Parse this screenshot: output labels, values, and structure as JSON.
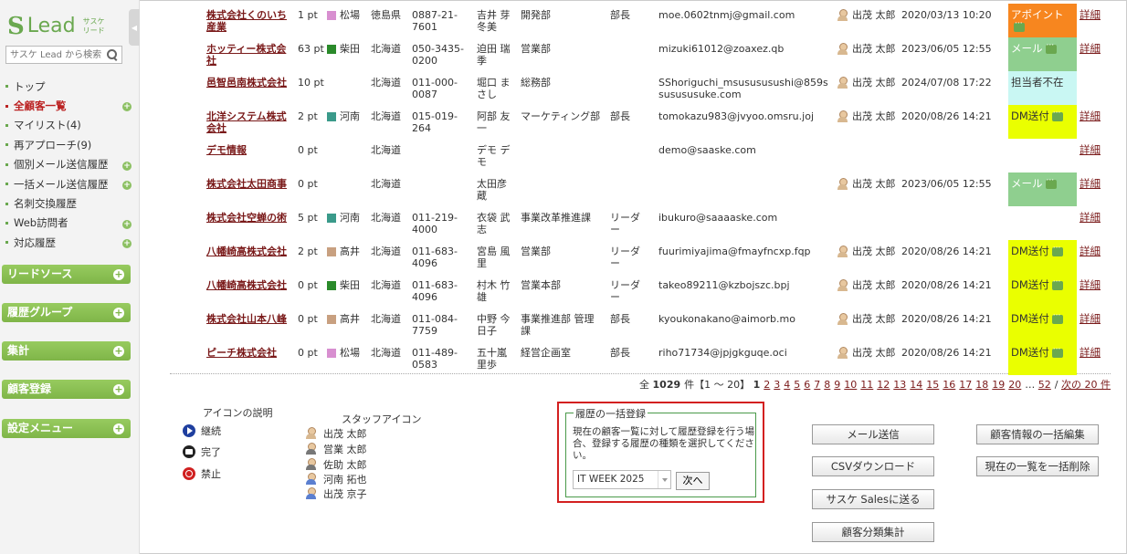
{
  "sidebar": {
    "logo_lead": "Lead",
    "logo_sub": "サスケ リード",
    "search_placeholder": "サスケ Lead から検索",
    "nav": [
      {
        "label": "トップ",
        "plus": false,
        "active": false
      },
      {
        "label": "全顧客一覧",
        "plus": true,
        "active": true
      },
      {
        "label": "マイリスト(4)",
        "plus": false,
        "active": false
      },
      {
        "label": "再アプローチ(9)",
        "plus": false,
        "active": false
      },
      {
        "label": "個別メール送信履歴",
        "plus": true,
        "active": false
      },
      {
        "label": "一括メール送信履歴",
        "plus": true,
        "active": false
      },
      {
        "label": "名刺交換履歴",
        "plus": false,
        "active": false
      },
      {
        "label": "Web訪問者",
        "plus": true,
        "active": false
      },
      {
        "label": "対応履歴",
        "plus": true,
        "active": false
      }
    ],
    "sections": [
      "リードソース",
      "履歴グループ",
      "集計",
      "顧客登録",
      "設定メニュー"
    ]
  },
  "rows": [
    {
      "company": "株式会社くのいち産業",
      "pt": "1 pt",
      "color": "#d88fd0",
      "staff": "松場",
      "pref": "徳島県",
      "tel": "0887-21-7601",
      "name": "吉井 芽冬美",
      "dept": "開発部",
      "title": "部長",
      "email": "moe.0602tnmj@gmail.com",
      "person": "出茂 太郎",
      "date": "2020/03/13 10:20",
      "status": "アポイント",
      "status_class": "st-appt",
      "bubble": true,
      "detail": "詳細"
    },
    {
      "company": "ホッティー株式会社",
      "pt": "63 pt",
      "color": "#2a8a2a",
      "staff": "柴田",
      "pref": "北海道",
      "tel": "050-3435-0200",
      "name": "迫田 瑞季",
      "dept": "営業部",
      "title": "",
      "email": "mizuki61012@zoaxez.qb",
      "person": "出茂 太郎",
      "date": "2023/06/05 12:55",
      "status": "メール",
      "status_class": "st-mail",
      "bubble": true,
      "detail": "詳細"
    },
    {
      "company": "邑智邑南株式会社",
      "pt": "10 pt",
      "color": "",
      "staff": "",
      "pref": "北海道",
      "tel": "011-000-0087",
      "name": "堀口 まさし",
      "dept": "総務部",
      "title": "",
      "email": "SShoriguchi_msusususushi@859ssusususuke.com",
      "person": "出茂 太郎",
      "date": "2024/07/08 17:22",
      "status": "担当者不在",
      "status_class": "st-absent",
      "bubble": false,
      "detail": ""
    },
    {
      "company": "北洋システム株式会社",
      "pt": "2 pt",
      "color": "#3a9a8a",
      "staff": "河南",
      "pref": "北海道",
      "tel": "015-019-264",
      "name": "阿部 友一",
      "dept": "マーケティング部",
      "title": "部長",
      "email": "tomokazu983@jvyoo.omsru.joj",
      "person": "出茂 太郎",
      "date": "2020/08/26 14:21",
      "status": "DM送付",
      "status_class": "st-dm",
      "bubble": true,
      "detail": "詳細"
    },
    {
      "company": "デモ情報",
      "pt": "0 pt",
      "color": "",
      "staff": "",
      "pref": "北海道",
      "tel": "",
      "name": "デモ デモ",
      "dept": "",
      "title": "",
      "email": "demo@saaske.com",
      "person": "",
      "date": "",
      "status": "",
      "status_class": "",
      "bubble": false,
      "detail": "詳細"
    },
    {
      "company": "株式会社太田商事",
      "pt": "0 pt",
      "color": "",
      "staff": "",
      "pref": "北海道",
      "tel": "",
      "name": "太田彦蔵",
      "dept": "",
      "title": "",
      "email": "",
      "person": "出茂 太郎",
      "date": "2023/06/05 12:55",
      "status": "メール",
      "status_class": "st-mail",
      "bubble": true,
      "detail": "詳細"
    },
    {
      "company": "株式会社空蝉の術",
      "pt": "5 pt",
      "color": "#3a9a8a",
      "staff": "河南",
      "pref": "北海道",
      "tel": "011-219-4000",
      "name": "衣袋 武志",
      "dept": "事業改革推進課",
      "title": "リーダー",
      "email": "ibukuro@saaaaske.com",
      "person": "",
      "date": "",
      "status": "",
      "status_class": "",
      "bubble": false,
      "detail": "詳細"
    },
    {
      "company": "八幡崎高株式会社",
      "pt": "2 pt",
      "color": "#c8a080",
      "staff": "高井",
      "pref": "北海道",
      "tel": "011-683-4096",
      "name": "宮島 風里",
      "dept": "営業部",
      "title": "リーダー",
      "email": "fuurimiyajima@fmayfncxp.fqp",
      "person": "出茂 太郎",
      "date": "2020/08/26 14:21",
      "status": "DM送付",
      "status_class": "st-dm",
      "bubble": true,
      "detail": "詳細"
    },
    {
      "company": "八幡崎高株式会社",
      "pt": "0 pt",
      "color": "#2a8a2a",
      "staff": "柴田",
      "pref": "北海道",
      "tel": "011-683-4096",
      "name": "村木 竹雄",
      "dept": "営業本部",
      "title": "リーダー",
      "email": "takeo89211@kzbojszc.bpj",
      "person": "出茂 太郎",
      "date": "2020/08/26 14:21",
      "status": "DM送付",
      "status_class": "st-dm",
      "bubble": true,
      "detail": "詳細"
    },
    {
      "company": "株式会社山本八峰",
      "pt": "0 pt",
      "color": "#c8a080",
      "staff": "高井",
      "pref": "北海道",
      "tel": "011-084-7759",
      "name": "中野 今日子",
      "dept": "事業推進部 管理課",
      "title": "部長",
      "email": "kyoukonakano@aimorb.mo",
      "person": "出茂 太郎",
      "date": "2020/08/26 14:21",
      "status": "DM送付",
      "status_class": "st-dm",
      "bubble": true,
      "detail": "詳細"
    },
    {
      "company": "ピーチ株式会社",
      "pt": "0 pt",
      "color": "#d88fd0",
      "staff": "松場",
      "pref": "北海道",
      "tel": "011-489-0583",
      "name": "五十嵐 里歩",
      "dept": "経営企画室",
      "title": "部長",
      "email": "riho71734@jpjgkguqe.oci",
      "person": "出茂 太郎",
      "date": "2020/08/26 14:21",
      "status": "DM送付",
      "status_class": "st-dm",
      "bubble": true,
      "detail": "詳細"
    }
  ],
  "pager": {
    "total_prefix": "全",
    "total": "1029",
    "total_suffix": "件【1 ～ 20】",
    "current": "1",
    "pages": [
      "2",
      "3",
      "4",
      "5",
      "6",
      "7",
      "8",
      "9",
      "10",
      "11",
      "12",
      "13",
      "14",
      "15",
      "16",
      "17",
      "18",
      "19",
      "20"
    ],
    "ellipsis": "…",
    "last": "52",
    "next": "次の 20 件"
  },
  "icon_legend": {
    "title": "アイコンの説明",
    "items": [
      "継続",
      "完了",
      "禁止"
    ]
  },
  "staff_legend": {
    "title": "スタッフアイコン",
    "items": [
      "出茂 太郎",
      "営業 太郎",
      "佐助 太郎",
      "河南 拓也",
      "出茂 京子"
    ]
  },
  "bulk": {
    "legend": "履歴の一括登録",
    "desc": "現在の顧客一覧に対して履歴登録を行う場合、登録する履歴の種類を選択してください。",
    "selected": "IT WEEK 2025",
    "next": "次へ"
  },
  "buttons": {
    "mail": "メール送信",
    "csv": "CSVダウンロード",
    "sales": "サスケ Salesに送る",
    "category": "顧客分類集計",
    "bulk_edit": "顧客情報の一括編集",
    "bulk_delete": "現在の一覧を一括削除"
  }
}
